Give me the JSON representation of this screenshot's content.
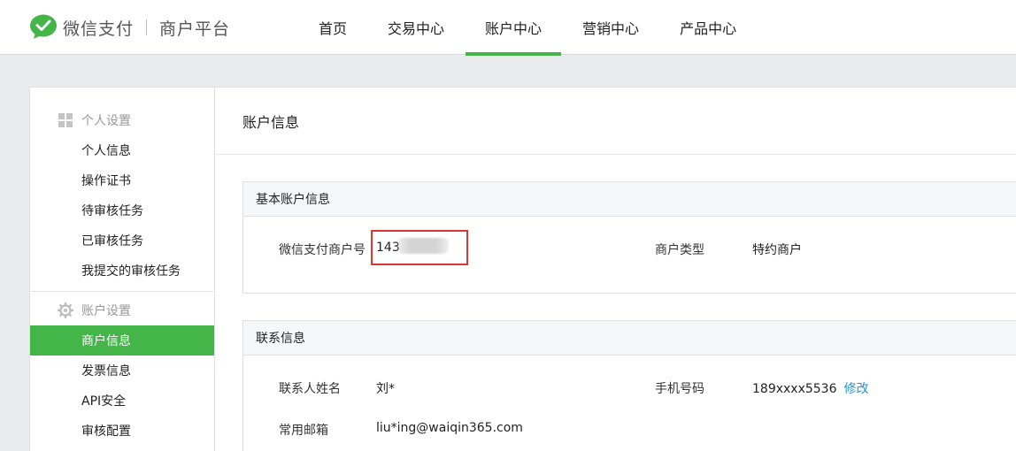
{
  "header": {
    "brand": "微信支付",
    "subbrand": "商户平台",
    "nav": [
      {
        "label": "首页",
        "active": false
      },
      {
        "label": "交易中心",
        "active": false
      },
      {
        "label": "账户中心",
        "active": true
      },
      {
        "label": "营销中心",
        "active": false
      },
      {
        "label": "产品中心",
        "active": false
      }
    ]
  },
  "sidebar": {
    "groups": [
      {
        "title": "个人设置",
        "icon": "grid-icon",
        "items": [
          "个人信息",
          "操作证书",
          "待审核任务",
          "已审核任务",
          "我提交的审核任务"
        ]
      },
      {
        "title": "账户设置",
        "icon": "gear-icon",
        "items": [
          "商户信息",
          "发票信息",
          "API安全",
          "审核配置"
        ]
      }
    ],
    "active_item": "商户信息"
  },
  "main": {
    "title": "账户信息",
    "basic": {
      "head": "基本账户信息",
      "merchant_id_label": "微信支付商户号",
      "merchant_id_value": "143",
      "type_label": "商户类型",
      "type_value": "特约商户"
    },
    "contact": {
      "head": "联系信息",
      "name_label": "联系人姓名",
      "name_value": "刘*",
      "phone_label": "手机号码",
      "phone_value": "189xxxx5536",
      "phone_edit": "修改",
      "email_label": "常用邮箱",
      "email_value": "liu*ing@waiqin365.com"
    }
  },
  "colors": {
    "accent": "#44b549",
    "link": "#2d8fd5",
    "highlight": "#d9372f"
  }
}
